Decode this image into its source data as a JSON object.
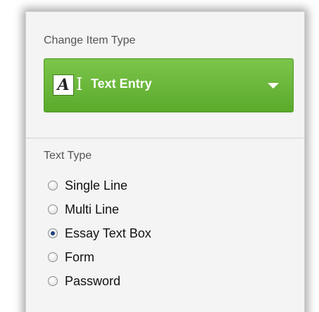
{
  "change_item_type": {
    "heading": "Change Item Type",
    "selected": {
      "icon": "text-entry-icon",
      "label": "Text Entry"
    }
  },
  "text_type": {
    "heading": "Text Type",
    "options": [
      {
        "label": "Single Line",
        "checked": false
      },
      {
        "label": "Multi Line",
        "checked": false
      },
      {
        "label": "Essay Text Box",
        "checked": true
      },
      {
        "label": "Form",
        "checked": false
      },
      {
        "label": "Password",
        "checked": false
      }
    ]
  },
  "colors": {
    "dropdown_green": "#5aaa2c",
    "panel_background": "#f4f4f4"
  }
}
